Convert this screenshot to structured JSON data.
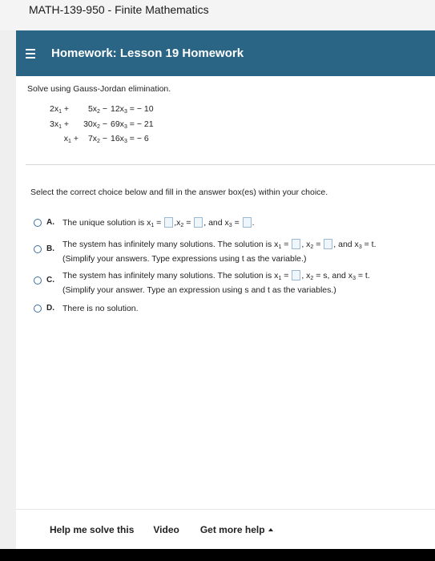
{
  "course_title": "MATH-139-950 - Finite Mathematics",
  "header": {
    "title": "Homework: Lesson 19 Homework"
  },
  "problem": {
    "prompt": "Solve using Gauss-Jordan elimination.",
    "equations": [
      {
        "a": "2x",
        "asub": "1",
        "op1": "+",
        "b": "5x",
        "bsub": "2",
        "op2": "−",
        "c": "12x",
        "csub": "3",
        "rhs": "= − 10"
      },
      {
        "a": "3x",
        "asub": "1",
        "op1": "+",
        "b": "30x",
        "bsub": "2",
        "op2": "−",
        "c": "69x",
        "csub": "3",
        "rhs": "= − 21"
      },
      {
        "a": "x",
        "asub": "1",
        "op1": "+",
        "b": "7x",
        "bsub": "2",
        "op2": "−",
        "c": "16x",
        "csub": "3",
        "rhs": "=  − 6"
      }
    ]
  },
  "instruction": "Select the correct choice below and fill in the answer box(es) within your choice.",
  "choices": {
    "a": {
      "letter": "A.",
      "t1": "The unique solution is x",
      "s1": "1",
      "t2": " = ",
      "t3": ",x",
      "s3": "2",
      "t4": " = ",
      "t5": ", and x",
      "s5": "3",
      "t6": " = ",
      "t7": "."
    },
    "b": {
      "letter": "B.",
      "t1": "The system has infinitely many solutions. The solution is x",
      "s1": "1",
      "t2": " = ",
      "t3": ", x",
      "s3": "2",
      "t4": " = ",
      "t5": ", and x",
      "s5": "3",
      "t6": " = t.",
      "note": "(Simplify your answers. Type expressions using t as the variable.)"
    },
    "c": {
      "letter": "C.",
      "t1": "The system has infinitely many solutions. The solution is x",
      "s1": "1",
      "t2": " = ",
      "t3": ", x",
      "s3": "2",
      "t4": " = s, and x",
      "s5": "3",
      "t6": " = t.",
      "note": "(Simplify your answer. Type an expression using s and t as the variables.)"
    },
    "d": {
      "letter": "D.",
      "text": "There is no solution."
    }
  },
  "footer": {
    "help": "Help me solve this",
    "video": "Video",
    "more": "Get more help"
  }
}
